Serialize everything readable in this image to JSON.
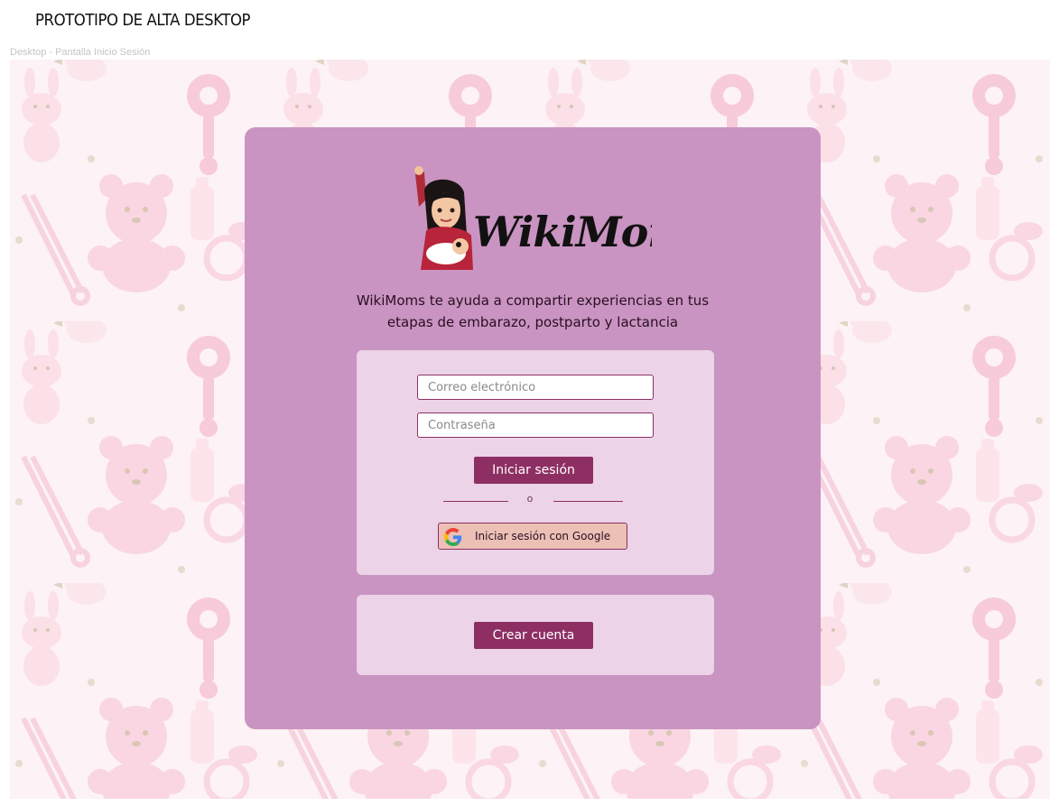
{
  "header": {
    "title": "PROTOTIPO DE ALTA DESKTOP",
    "frame_label": "Desktop - Pantalla Inicio Sesión"
  },
  "brand": {
    "name": "WikiMoms"
  },
  "tagline": {
    "line1": "WikiMoms te ayuda a compartir experiencias en tus",
    "line2": "etapas de embarazo, postparto y lactancia"
  },
  "login": {
    "email_placeholder": "Correo electrónico",
    "password_placeholder": "Contraseña",
    "submit_label": "Iniciar sesión",
    "divider_text": "o",
    "google_label": "Iniciar sesión con Google",
    "google_icon": "google-icon"
  },
  "signup": {
    "create_account_label": "Crear cuenta"
  },
  "colors": {
    "card_bg": "#c994c1",
    "panel_bg": "#ecd3e8",
    "primary_button": "#8e2f63",
    "google_button_bg": "#ecc0b5",
    "background_pattern": "#fdf3f6"
  }
}
